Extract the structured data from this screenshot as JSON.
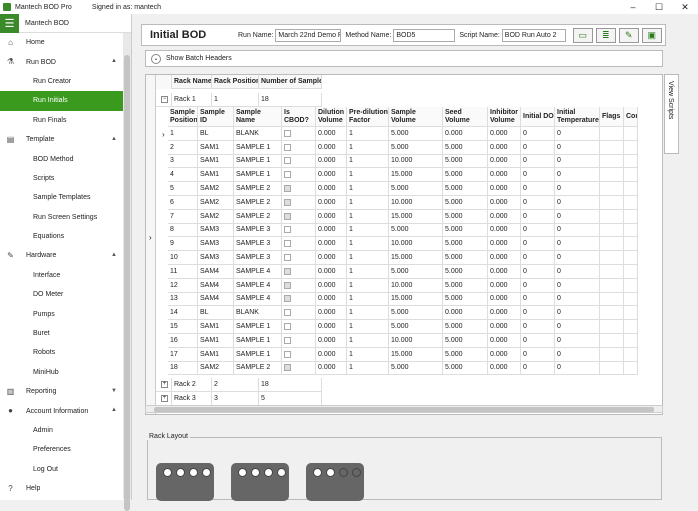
{
  "window": {
    "title": "Mantech BOD Pro",
    "signed_in": "Signed in as: mantech"
  },
  "sidebar": {
    "app_name": "Mantech BOD",
    "items": [
      {
        "label": "Home",
        "icon": "home-icon",
        "kind": "top"
      },
      {
        "label": "Run BOD",
        "icon": "run-icon",
        "kind": "top",
        "expanded": true
      },
      {
        "label": "Run Creator",
        "kind": "sub"
      },
      {
        "label": "Run Initials",
        "kind": "sub",
        "active": true
      },
      {
        "label": "Run Finals",
        "kind": "sub"
      },
      {
        "label": "Template",
        "icon": "template-icon",
        "kind": "top",
        "expanded": true
      },
      {
        "label": "BOD Method",
        "kind": "sub"
      },
      {
        "label": "Scripts",
        "kind": "sub"
      },
      {
        "label": "Sample Templates",
        "kind": "sub"
      },
      {
        "label": "Run Screen Settings",
        "kind": "sub"
      },
      {
        "label": "Equations",
        "kind": "sub"
      },
      {
        "label": "Hardware",
        "icon": "wrench-icon",
        "kind": "top",
        "expanded": true
      },
      {
        "label": "Interface",
        "kind": "sub"
      },
      {
        "label": "DO Meter",
        "kind": "sub"
      },
      {
        "label": "Pumps",
        "kind": "sub"
      },
      {
        "label": "Buret",
        "kind": "sub"
      },
      {
        "label": "Robots",
        "kind": "sub"
      },
      {
        "label": "MiniHub",
        "kind": "sub"
      },
      {
        "label": "Reporting",
        "icon": "chart-icon",
        "kind": "top",
        "expanded": false
      },
      {
        "label": "Account Information",
        "icon": "user-icon",
        "kind": "top",
        "expanded": true
      },
      {
        "label": "Admin",
        "kind": "sub"
      },
      {
        "label": "Preferences",
        "kind": "sub"
      },
      {
        "label": "Log Out",
        "kind": "sub"
      },
      {
        "label": "Help",
        "icon": "help-icon",
        "kind": "top"
      }
    ]
  },
  "toolbar": {
    "title": "Initial BOD",
    "run_name_label": "Run Name:",
    "run_name": "March 22nd Demo R",
    "method_name_label": "Method Name:",
    "method_name": "BOD5",
    "script_name_label": "Script Name:",
    "script_name": "BOD Run Auto 2"
  },
  "batch": {
    "label": "Show Batch Headers"
  },
  "view_scripts": "View Scripts",
  "outer_grid": {
    "headers": [
      "Rack Name",
      "Rack Position",
      "Number of Samples"
    ],
    "racks": [
      {
        "name": "Rack 1",
        "position": "1",
        "samples": "18",
        "expanded": true
      },
      {
        "name": "Rack 2",
        "position": "2",
        "samples": "18",
        "expanded": false
      },
      {
        "name": "Rack 3",
        "position": "3",
        "samples": "5",
        "expanded": false
      }
    ]
  },
  "inner_grid": {
    "headers": [
      "Sample Position",
      "Sample ID",
      "Sample Name",
      "Is CBOD?",
      "Dilution Volume",
      "Pre-dilution Factor",
      "Sample Volume",
      "Seed Volume",
      "Inhibitor Volume",
      "Initial DO",
      "Initial Temperature",
      "Flags",
      "Comm"
    ],
    "rows": [
      [
        "1",
        "BL",
        "BLANK",
        false,
        "0.000",
        "1",
        "5.000",
        "0.000",
        "0.000",
        "0",
        "0"
      ],
      [
        "2",
        "SAM1",
        "SAMPLE 1",
        false,
        "0.000",
        "1",
        "5.000",
        "5.000",
        "0.000",
        "0",
        "0"
      ],
      [
        "3",
        "SAM1",
        "SAMPLE 1",
        false,
        "0.000",
        "1",
        "10.000",
        "5.000",
        "0.000",
        "0",
        "0"
      ],
      [
        "4",
        "SAM1",
        "SAMPLE 1",
        false,
        "0.000",
        "1",
        "15.000",
        "5.000",
        "0.000",
        "0",
        "0"
      ],
      [
        "5",
        "SAM2",
        "SAMPLE 2",
        true,
        "0.000",
        "1",
        "5.000",
        "5.000",
        "0.000",
        "0",
        "0"
      ],
      [
        "6",
        "SAM2",
        "SAMPLE 2",
        true,
        "0.000",
        "1",
        "10.000",
        "5.000",
        "0.000",
        "0",
        "0"
      ],
      [
        "7",
        "SAM2",
        "SAMPLE 2",
        true,
        "0.000",
        "1",
        "15.000",
        "5.000",
        "0.000",
        "0",
        "0"
      ],
      [
        "8",
        "SAM3",
        "SAMPLE 3",
        false,
        "0.000",
        "1",
        "5.000",
        "5.000",
        "0.000",
        "0",
        "0"
      ],
      [
        "9",
        "SAM3",
        "SAMPLE 3",
        false,
        "0.000",
        "1",
        "10.000",
        "5.000",
        "0.000",
        "0",
        "0"
      ],
      [
        "10",
        "SAM3",
        "SAMPLE 3",
        false,
        "0.000",
        "1",
        "15.000",
        "5.000",
        "0.000",
        "0",
        "0"
      ],
      [
        "11",
        "SAM4",
        "SAMPLE 4",
        true,
        "0.000",
        "1",
        "5.000",
        "5.000",
        "0.000",
        "0",
        "0"
      ],
      [
        "12",
        "SAM4",
        "SAMPLE 4",
        true,
        "0.000",
        "1",
        "10.000",
        "5.000",
        "0.000",
        "0",
        "0"
      ],
      [
        "13",
        "SAM4",
        "SAMPLE 4",
        true,
        "0.000",
        "1",
        "15.000",
        "5.000",
        "0.000",
        "0",
        "0"
      ],
      [
        "14",
        "BL",
        "BLANK",
        false,
        "0.000",
        "1",
        "5.000",
        "0.000",
        "0.000",
        "0",
        "0"
      ],
      [
        "15",
        "SAM1",
        "SAMPLE 1",
        false,
        "0.000",
        "1",
        "5.000",
        "5.000",
        "0.000",
        "0",
        "0"
      ],
      [
        "16",
        "SAM1",
        "SAMPLE 1",
        false,
        "0.000",
        "1",
        "10.000",
        "5.000",
        "0.000",
        "0",
        "0"
      ],
      [
        "17",
        "SAM1",
        "SAMPLE 1",
        false,
        "0.000",
        "1",
        "15.000",
        "5.000",
        "0.000",
        "0",
        "0"
      ],
      [
        "18",
        "SAM2",
        "SAMPLE 2",
        true,
        "0.000",
        "1",
        "5.000",
        "5.000",
        "0.000",
        "0",
        "0"
      ]
    ]
  },
  "rack_layout": {
    "label": "Rack Layout"
  },
  "colors": {
    "accent": "#3a9a1e"
  }
}
